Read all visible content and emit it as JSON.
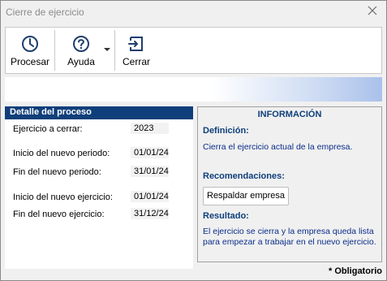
{
  "window": {
    "title": "Cierre de ejercicio"
  },
  "toolbar": {
    "procesar": "Procesar",
    "ayuda": "Ayuda",
    "cerrar": "Cerrar"
  },
  "detail": {
    "header": "Detalle del proceso",
    "rows": [
      {
        "label": "Ejercicio a cerrar:",
        "value": "2023"
      },
      {
        "label": "Inicio del nuevo periodo:",
        "value": "01/01/24"
      },
      {
        "label": "Fin del nuevo periodo:",
        "value": "31/01/24"
      },
      {
        "label": "Inicio del nuevo ejercicio:",
        "value": "01/01/24"
      },
      {
        "label": "Fin del nuevo ejercicio:",
        "value": "31/12/24"
      }
    ]
  },
  "info": {
    "title": "INFORMACIÓN",
    "definicion_heading": "Definición:",
    "definicion_text": "Cierra el ejercicio actual de la empresa.",
    "recomendaciones_heading": "Recomendaciones:",
    "respaldar_button": "Respaldar empresa",
    "resultado_heading": "Resultado:",
    "resultado_text": "El ejercicio se cierra y la empresa queda lista para empezar a trabajar en el nuevo ejercicio."
  },
  "footer": {
    "required_note": "* Obligatorio"
  },
  "colors": {
    "header_bg": "#0f3f7a",
    "info_text": "#0a2d8a",
    "icon": "#1f3f6e"
  },
  "icons": {
    "procesar": "clock-icon",
    "ayuda": "help-circle-icon",
    "cerrar": "exit-icon",
    "close": "close-icon",
    "dropdown": "caret-down-icon"
  }
}
